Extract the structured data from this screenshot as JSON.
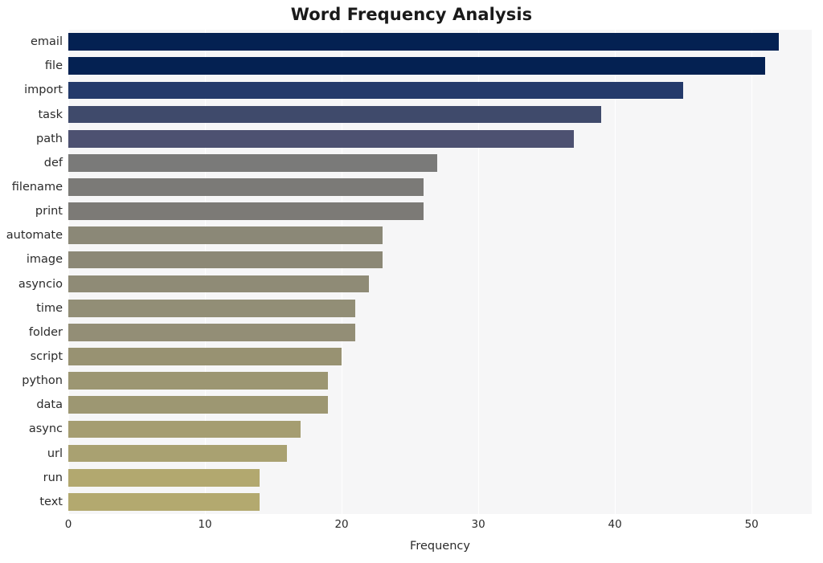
{
  "chart_data": {
    "type": "bar",
    "orientation": "horizontal",
    "title": "Word Frequency Analysis",
    "xlabel": "Frequency",
    "ylabel": "",
    "categories": [
      "email",
      "file",
      "import",
      "task",
      "path",
      "def",
      "filename",
      "print",
      "automate",
      "image",
      "asyncio",
      "time",
      "folder",
      "script",
      "python",
      "data",
      "async",
      "url",
      "run",
      "text"
    ],
    "values": [
      52,
      51,
      45,
      39,
      37,
      27,
      26,
      26,
      23,
      23,
      22,
      21,
      21,
      20,
      19,
      19,
      17,
      16,
      14,
      14
    ],
    "xticks": [
      0,
      10,
      20,
      30,
      40,
      50
    ],
    "xtick_labels": [
      "0",
      "10",
      "20",
      "30",
      "40",
      "50"
    ],
    "xlim": [
      0,
      54.4
    ],
    "grid": true,
    "grid_axis": "x",
    "legend": false,
    "bar_colors": [
      "#042152",
      "#042152",
      "#243a6b",
      "#3f4a6b",
      "#4d5171",
      "#7a7a79",
      "#7b7a77",
      "#7c7a76",
      "#8b8877",
      "#8c8876",
      "#8f8b76",
      "#928e76",
      "#938e76",
      "#989272",
      "#9c9672",
      "#9d9772",
      "#a59d71",
      "#a9a171",
      "#b2a86f",
      "#b3a96f"
    ],
    "plot_background": "#f6f6f7",
    "figure_background": "#ffffff",
    "title_color": "#1a1a1a",
    "tick_color": "#2b2b2b"
  }
}
